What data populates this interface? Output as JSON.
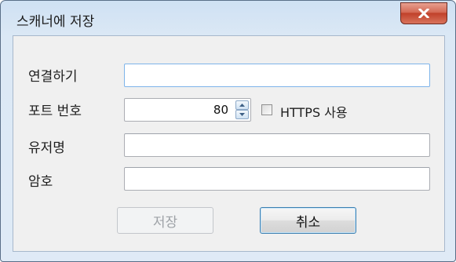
{
  "window": {
    "title": "스캐너에 저장",
    "close_icon": "close-x-icon"
  },
  "form": {
    "connect_label": "연결하기",
    "connect_value": "",
    "port_label": "포트 번호",
    "port_value": "80",
    "https_label": "HTTPS 사용",
    "https_checked": false,
    "username_label": "유저명",
    "username_value": "",
    "password_label": "암호",
    "password_value": ""
  },
  "buttons": {
    "save_label": "저장",
    "save_enabled": false,
    "cancel_label": "취소"
  },
  "colors": {
    "close_button": "#c0412a",
    "title_bar": "#cfe1f3",
    "focus_border": "#7eb4ea",
    "default_button_border": "#3c7fb1"
  }
}
